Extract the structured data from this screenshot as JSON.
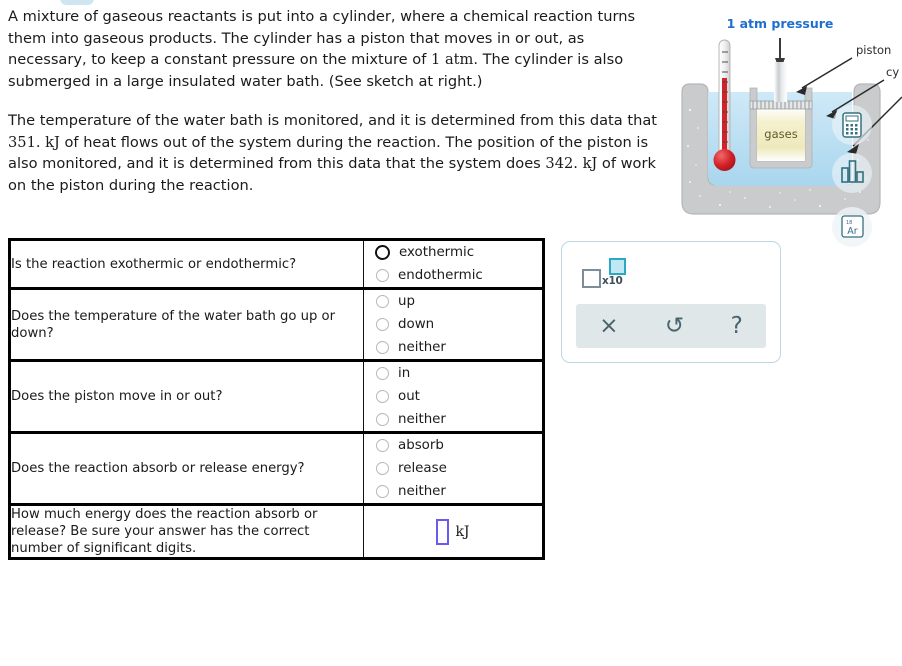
{
  "statement": {
    "paragraph1_a": "A mixture of gaseous reactants is put into a cylinder, where a chemical reaction turns them into gaseous products. The cylinder has a piston that moves in or out, as necessary, to keep a constant pressure on the mixture of ",
    "paragraph1_pressure": "1",
    "paragraph1_pressure_unit": "atm",
    "paragraph1_b": ". The cylinder is also submerged in a large insulated water bath. (See sketch at right.)",
    "paragraph2_a": "The temperature of the water bath is monitored, and it is determined from this data that ",
    "paragraph2_heat": "351.",
    "paragraph2_heat_unit": "kJ",
    "paragraph2_b": " of heat flows out of the system during the reaction. The position of the piston is also monitored, and it is determined from this data that the system does ",
    "paragraph2_work": "342.",
    "paragraph2_work_unit": "kJ",
    "paragraph2_c": " of work on the piston during the reaction."
  },
  "sketch": {
    "pressure_label": "1 atm pressure",
    "piston_label": "piston",
    "cylinder_label": "cy",
    "gases_label": "gases",
    "calculator_icon": "calculator-icon",
    "data_icon": "bar-chart-icon",
    "periodic_icon": "periodic-table-icon",
    "periodic_number": "18",
    "periodic_symbol": "Ar"
  },
  "table": {
    "rows": [
      {
        "question": "Is the reaction exothermic or endothermic?",
        "options": [
          {
            "label": "exothermic",
            "state": "hovered"
          },
          {
            "label": "endothermic",
            "state": "normal"
          }
        ]
      },
      {
        "question": "Does the temperature of the water bath go up or down?",
        "options": [
          {
            "label": "up",
            "state": "normal"
          },
          {
            "label": "down",
            "state": "normal"
          },
          {
            "label": "neither",
            "state": "normal"
          }
        ]
      },
      {
        "question": "Does the piston move in or out?",
        "options": [
          {
            "label": "in",
            "state": "normal"
          },
          {
            "label": "out",
            "state": "normal"
          },
          {
            "label": "neither",
            "state": "normal"
          }
        ]
      },
      {
        "question": "Does the reaction absorb or release energy?",
        "options": [
          {
            "label": "absorb",
            "state": "normal"
          },
          {
            "label": "release",
            "state": "normal"
          },
          {
            "label": "neither",
            "state": "normal"
          }
        ]
      }
    ],
    "energy_row": {
      "question": "How much energy does the reaction absorb or release? Be sure your answer has the correct number of significant digits.",
      "input_value": "",
      "unit": "kJ"
    }
  },
  "toolbar": {
    "sci_notation_label": "x10",
    "clear_icon": "×",
    "undo_icon": "↺",
    "help_icon": "?"
  },
  "colors": {
    "accent_blue": "#1f6fd0",
    "input_border": "#6a5bef",
    "toolbar_bg": "#dfe7e9",
    "panel_border": "#bcd7e3",
    "water": "#b8def2",
    "container_gray": "#c9cbcc",
    "gases_fill": "#f2eec4",
    "mercury_red": "#d3222a",
    "exp_cyan": "#2aa8c4"
  }
}
